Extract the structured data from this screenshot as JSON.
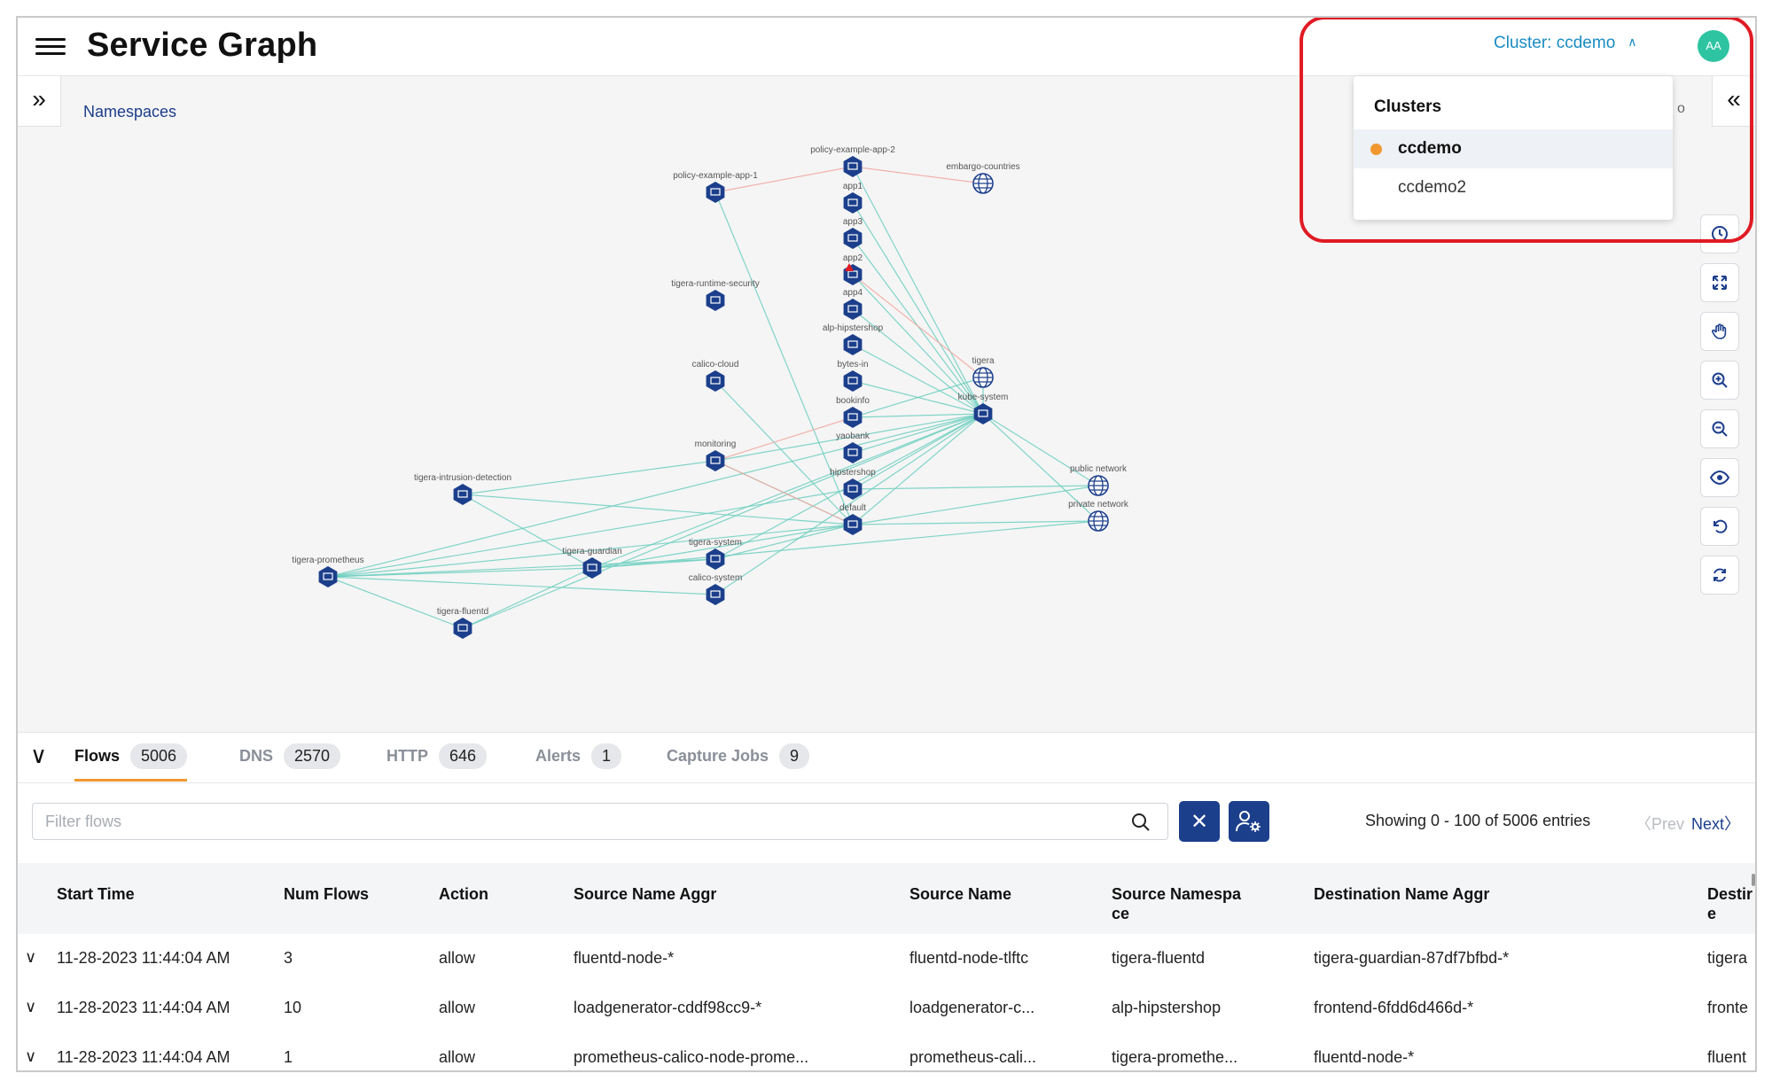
{
  "header": {
    "title": "Service Graph",
    "cluster_label": "Cluster: ccdemo",
    "avatar_initials": "AA"
  },
  "graph": {
    "breadcrumb": "Namespaces",
    "partial_label": "o",
    "nodes": [
      {
        "label": "policy-example-app-2",
        "type": "namespace"
      },
      {
        "label": "policy-example-app-1",
        "type": "namespace"
      },
      {
        "label": "embargo-countries",
        "type": "network"
      },
      {
        "label": "app1",
        "type": "namespace"
      },
      {
        "label": "app3",
        "type": "namespace"
      },
      {
        "label": "app2",
        "type": "namespace"
      },
      {
        "label": "app4",
        "type": "namespace"
      },
      {
        "label": "tigera-runtime-security",
        "type": "namespace"
      },
      {
        "label": "alp-hipstershop",
        "type": "namespace"
      },
      {
        "label": "calico-cloud",
        "type": "namespace"
      },
      {
        "label": "bytes-in",
        "type": "namespace"
      },
      {
        "label": "tigera",
        "type": "network"
      },
      {
        "label": "kube-system",
        "type": "namespace"
      },
      {
        "label": "bookinfo",
        "type": "namespace"
      },
      {
        "label": "yaobank",
        "type": "namespace"
      },
      {
        "label": "monitoring",
        "type": "namespace"
      },
      {
        "label": "tigera-intrusion-detection",
        "type": "namespace"
      },
      {
        "label": "hipstershop",
        "type": "namespace"
      },
      {
        "label": "public network",
        "type": "network"
      },
      {
        "label": "private network",
        "type": "network"
      },
      {
        "label": "default",
        "type": "namespace"
      },
      {
        "label": "tigera-prometheus",
        "type": "namespace"
      },
      {
        "label": "tigera-guardian",
        "type": "namespace"
      },
      {
        "label": "tigera-system",
        "type": "namespace"
      },
      {
        "label": "calico-system",
        "type": "namespace"
      },
      {
        "label": "tigera-fluentd",
        "type": "namespace"
      }
    ]
  },
  "cluster_dropdown": {
    "header": "Clusters",
    "options": [
      {
        "label": "ccdemo",
        "selected": true
      },
      {
        "label": "ccdemo2",
        "selected": false
      }
    ]
  },
  "tools": [
    "clock-icon",
    "fit-screen-icon",
    "hand-pan-icon",
    "zoom-in-icon",
    "zoom-out-icon",
    "eye-icon",
    "undo-icon",
    "refresh-icon"
  ],
  "tabs": [
    {
      "label": "Flows",
      "count": "5006",
      "active": true
    },
    {
      "label": "DNS",
      "count": "2570",
      "active": false
    },
    {
      "label": "HTTP",
      "count": "646",
      "active": false
    },
    {
      "label": "Alerts",
      "count": "1",
      "active": false
    },
    {
      "label": "Capture Jobs",
      "count": "9",
      "active": false
    }
  ],
  "filter": {
    "placeholder": "Filter flows",
    "value": ""
  },
  "pagination": {
    "showing": "Showing 0 - 100 of 5006 entries",
    "prev": "Prev",
    "next": "Next"
  },
  "table": {
    "columns": [
      [
        "Start Time"
      ],
      [
        "Num Flows"
      ],
      [
        "Action"
      ],
      [
        "Source Name Aggr"
      ],
      [
        "Source Name"
      ],
      [
        "Source Namespa",
        "ce"
      ],
      [
        "Destination Name Aggr"
      ],
      [
        "Destir",
        "e"
      ]
    ],
    "rows": [
      [
        "11-28-2023 11:44:04 AM",
        "3",
        "allow",
        "fluentd-node-*",
        "fluentd-node-tlftc",
        "tigera-fluentd",
        "tigera-guardian-87df7bfbd-*",
        "tigera"
      ],
      [
        "11-28-2023 11:44:04 AM",
        "10",
        "allow",
        "loadgenerator-cddf98cc9-*",
        "loadgenerator-c...",
        "alp-hipstershop",
        "frontend-6fdd6d466d-*",
        "fronte"
      ],
      [
        "11-28-2023 11:44:04 AM",
        "1",
        "allow",
        "prometheus-calico-node-prome...",
        "prometheus-cali...",
        "tigera-promethe...",
        "fluentd-node-*",
        "fluent"
      ]
    ]
  },
  "colors": {
    "brand_dark_blue": "#1c3f8c",
    "cluster_link": "#1a8cc4",
    "avatar_bg": "#2ec4a2",
    "active_tab_underline": "#f0982f",
    "selected_dot": "#f0982f",
    "edge_allow": "#6ccfbf",
    "edge_deny": "#f2a7a0",
    "highlight": "#e01b24"
  }
}
